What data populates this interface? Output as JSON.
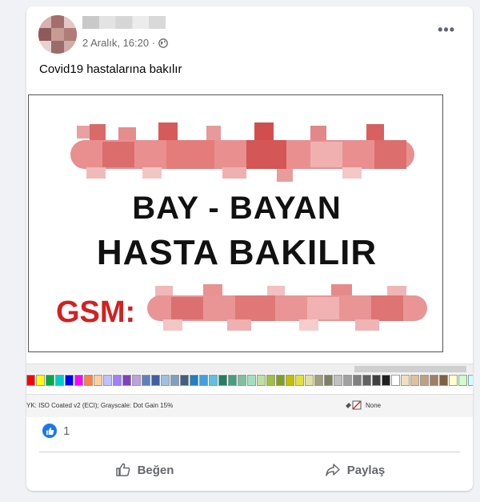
{
  "post": {
    "timestamp": "2 Aralık, 16:20 ·",
    "privacy_icon": "globe-icon",
    "caption": "Covid19 hastalarına bakılır",
    "more_label": "•••"
  },
  "sign": {
    "line1": "BAY - BAYAN",
    "line2": "HASTA BAKILIR",
    "gsm_label": "GSM:",
    "text_color": "#111111",
    "gsm_color": "#d22121"
  },
  "editor": {
    "color_profile": "YK: ISO Coated v2 (ECI); Grayscale: Dot Gain 15%",
    "fill_label": "None",
    "palette": [
      "#ff0000",
      "#ffff00",
      "#00aa44",
      "#00cccc",
      "#0000ff",
      "#ff00ff",
      "#ff8040",
      "#ffd0a0",
      "#c0c0ff",
      "#a080ff",
      "#8040c0",
      "#c0a0e0",
      "#6080c0",
      "#4060a0",
      "#a0c0e0",
      "#80a0c0",
      "#406080",
      "#2080c0",
      "#40a0e0",
      "#60c0e0",
      "#208060",
      "#40a080",
      "#80c0a0",
      "#a0e0c0",
      "#c0e0a0",
      "#a0c040",
      "#80a020",
      "#c0c000",
      "#e0e040",
      "#e0e0a0",
      "#a0a080",
      "#808060",
      "#c0c0c0",
      "#a0a0a0",
      "#808080",
      "#606060",
      "#404040",
      "#202020",
      "#ffffff",
      "#f0e0c0",
      "#e0c0a0",
      "#c0a080",
      "#a08060",
      "#806040",
      "#ffffcc",
      "#ccffcc",
      "#ccffff"
    ]
  },
  "reactions": {
    "count": "1",
    "icon": "like-icon"
  },
  "actions": {
    "like_label": "Beğen",
    "share_label": "Paylaş"
  }
}
